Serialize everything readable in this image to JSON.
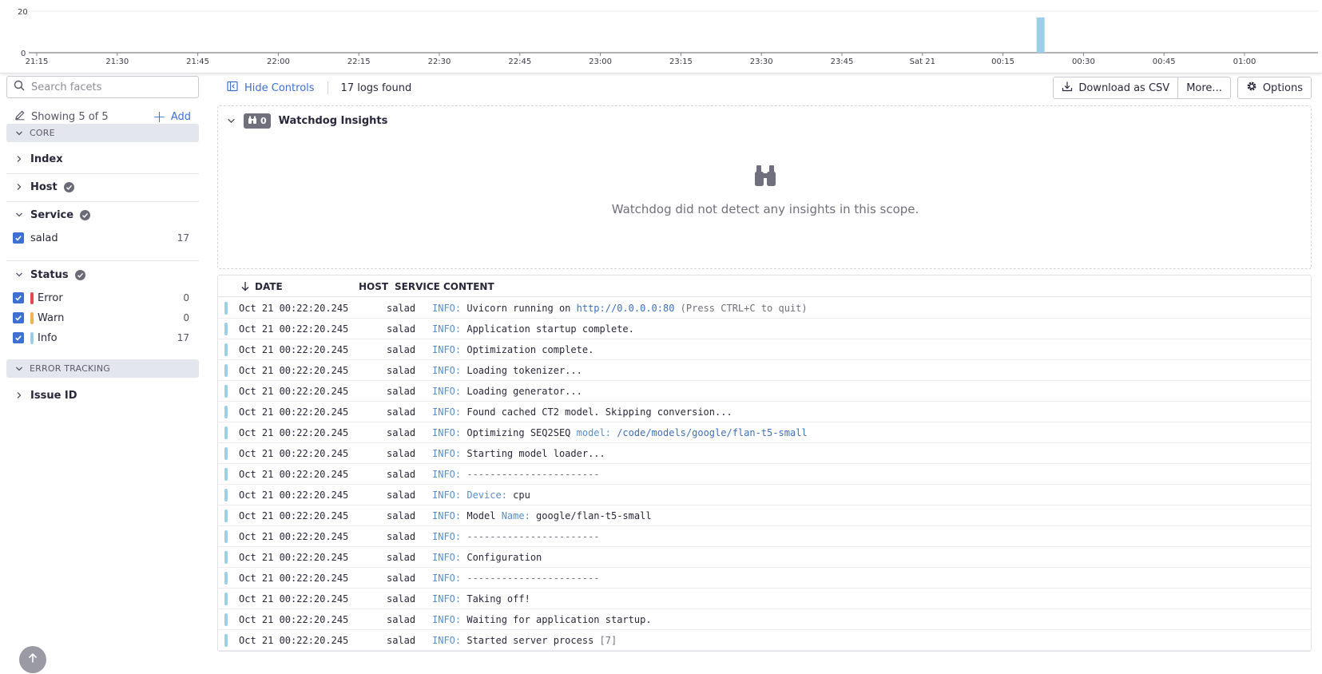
{
  "timeline": {
    "y_ticks": [
      "20",
      "0"
    ],
    "x_ticks": [
      "21:15",
      "21:30",
      "21:45",
      "22:00",
      "22:15",
      "22:30",
      "22:45",
      "23:00",
      "23:15",
      "23:30",
      "23:45",
      "Sat 21",
      "00:15",
      "00:30",
      "00:45",
      "01:00"
    ],
    "bar_color": "#9ccee7"
  },
  "chart_data": {
    "type": "bar",
    "ylim": [
      0,
      20
    ],
    "y_ticks": [
      0,
      20
    ],
    "categories": [
      "00:22"
    ],
    "values": [
      17
    ],
    "title": "",
    "xlabel": "",
    "ylabel": ""
  },
  "sidebar": {
    "search_placeholder": "Search facets",
    "showing_label": "Showing 5 of 5",
    "add_label": "Add",
    "sections": {
      "core": "CORE",
      "error_tracking": "ERROR TRACKING"
    },
    "facets": {
      "index": "Index",
      "host": "Host",
      "service": "Service",
      "status": "Status",
      "issue_id": "Issue ID"
    },
    "service_values": [
      {
        "label": "salad",
        "count": "17"
      }
    ],
    "status_values": [
      {
        "label": "Error",
        "count": "0",
        "color": "#e5484d"
      },
      {
        "label": "Warn",
        "count": "0",
        "color": "#f2b453"
      },
      {
        "label": "Info",
        "count": "17",
        "color": "#9ccee7"
      }
    ]
  },
  "toolbar": {
    "hide_controls": "Hide Controls",
    "logs_found": "17 logs found",
    "download_csv": "Download as CSV",
    "more": "More...",
    "options": "Options"
  },
  "watchdog": {
    "count": "0",
    "title": "Watchdog Insights",
    "empty_text": "Watchdog did not detect any insights in this scope."
  },
  "log_table": {
    "columns": {
      "date": "DATE",
      "host": "HOST",
      "service": "SERVICE",
      "content": "CONTENT"
    },
    "level_label": "INFO:",
    "rows": [
      {
        "date": "Oct 21 00:22:20.245",
        "service": "salad",
        "parts": [
          [
            "t",
            " Uvicorn running on "
          ],
          [
            "v",
            "http://0.0.0.0:80"
          ],
          [
            "d",
            " (Press CTRL+C to quit)"
          ]
        ]
      },
      {
        "date": "Oct 21 00:22:20.245",
        "service": "salad",
        "parts": [
          [
            "t",
            " Application startup complete."
          ]
        ]
      },
      {
        "date": "Oct 21 00:22:20.245",
        "service": "salad",
        "parts": [
          [
            "t",
            " Optimization complete."
          ]
        ]
      },
      {
        "date": "Oct 21 00:22:20.245",
        "service": "salad",
        "parts": [
          [
            "t",
            " Loading tokenizer..."
          ]
        ]
      },
      {
        "date": "Oct 21 00:22:20.245",
        "service": "salad",
        "parts": [
          [
            "t",
            " Loading generator..."
          ]
        ]
      },
      {
        "date": "Oct 21 00:22:20.245",
        "service": "salad",
        "parts": [
          [
            "t",
            " Found cached CT2 model. Skipping conversion..."
          ]
        ]
      },
      {
        "date": "Oct 21 00:22:20.245",
        "service": "salad",
        "parts": [
          [
            "t",
            " Optimizing SEQ2SEQ "
          ],
          [
            "k",
            "model:"
          ],
          [
            "v",
            " /code/models/google/flan-t5-small"
          ]
        ]
      },
      {
        "date": "Oct 21 00:22:20.245",
        "service": "salad",
        "parts": [
          [
            "t",
            " Starting model loader..."
          ]
        ]
      },
      {
        "date": "Oct 21 00:22:20.245",
        "service": "salad",
        "parts": [
          [
            "d",
            " -----------------------"
          ]
        ]
      },
      {
        "date": "Oct 21 00:22:20.245",
        "service": "salad",
        "parts": [
          [
            "t",
            " "
          ],
          [
            "k",
            "Device:"
          ],
          [
            "t",
            " cpu"
          ]
        ]
      },
      {
        "date": "Oct 21 00:22:20.245",
        "service": "salad",
        "parts": [
          [
            "t",
            " Model "
          ],
          [
            "k",
            "Name:"
          ],
          [
            "t",
            " google/flan-t5-small"
          ]
        ]
      },
      {
        "date": "Oct 21 00:22:20.245",
        "service": "salad",
        "parts": [
          [
            "d",
            " -----------------------"
          ]
        ]
      },
      {
        "date": "Oct 21 00:22:20.245",
        "service": "salad",
        "parts": [
          [
            "t",
            " Configuration"
          ]
        ]
      },
      {
        "date": "Oct 21 00:22:20.245",
        "service": "salad",
        "parts": [
          [
            "d",
            " -----------------------"
          ]
        ]
      },
      {
        "date": "Oct 21 00:22:20.245",
        "service": "salad",
        "parts": [
          [
            "t",
            " Taking off!"
          ]
        ]
      },
      {
        "date": "Oct 21 00:22:20.245",
        "service": "salad",
        "parts": [
          [
            "t",
            " Waiting for application startup."
          ]
        ]
      },
      {
        "date": "Oct 21 00:22:20.245",
        "service": "salad",
        "parts": [
          [
            "t",
            " Started server process "
          ],
          [
            "d",
            "[7]"
          ]
        ]
      }
    ]
  },
  "icons": {
    "search": "search-icon",
    "pencil": "pencil-icon",
    "hide_controls": "sidebar-collapse-icon",
    "download": "download-icon",
    "gear": "gear-icon",
    "binoculars": "binoculars-icon",
    "sort": "arrow-down-icon",
    "scroll_top": "arrow-up-icon"
  },
  "colors": {
    "accent": "#3e6fd1",
    "info": "#9ccee7"
  }
}
